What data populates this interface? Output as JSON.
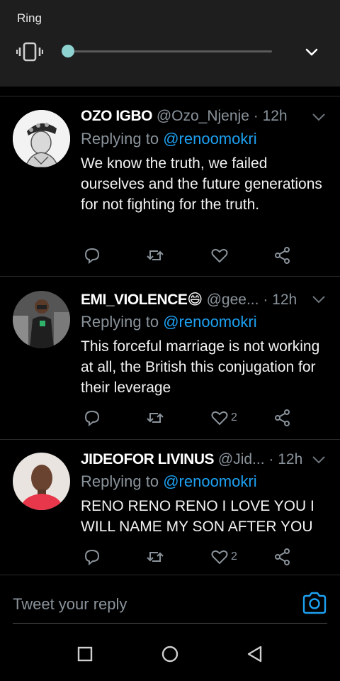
{
  "volume_panel": {
    "label": "Ring",
    "level": 0.0,
    "vibrate_icon": "vibrate-icon",
    "expand_icon": "chevron-down-icon"
  },
  "tweets": [
    {
      "name": "OZO IGBO",
      "handle": "@Ozo_Njenje",
      "separator": "·",
      "time": "12h",
      "replying_prefix": "Replying to",
      "replying_to": "@renoomokri",
      "text": "We know the truth, we failed ourselves and the future generations for not fighting for the truth.",
      "like_count": ""
    },
    {
      "name": "EMI_VIOLENCE😄",
      "handle": "@gee...",
      "separator": "·",
      "time": "12h",
      "replying_prefix": "Replying to",
      "replying_to": "@renoomokri",
      "text": "This forceful marriage is not working at all, the British this conjugation for their leverage",
      "like_count": "2"
    },
    {
      "name": "JIDEOFOR LIVINUS",
      "handle": "@Jid...",
      "separator": "·",
      "time": "12h",
      "replying_prefix": "Replying to",
      "replying_to": "@renoomokri",
      "text": "RENO RENO RENO I LOVE YOU I WILL NAME MY SON AFTER YOU",
      "like_count": "2"
    }
  ],
  "reply_box": {
    "placeholder": "Tweet your reply",
    "camera_icon": "camera-icon"
  },
  "colors": {
    "background": "#000000",
    "panel": "#1e1e1e",
    "accent": "#1da1f2",
    "slider_thumb": "#8fd3d0",
    "muted": "#8a939b"
  },
  "nav_bar": {
    "icons": [
      "recents-square-icon",
      "home-circle-icon",
      "back-triangle-icon"
    ]
  }
}
